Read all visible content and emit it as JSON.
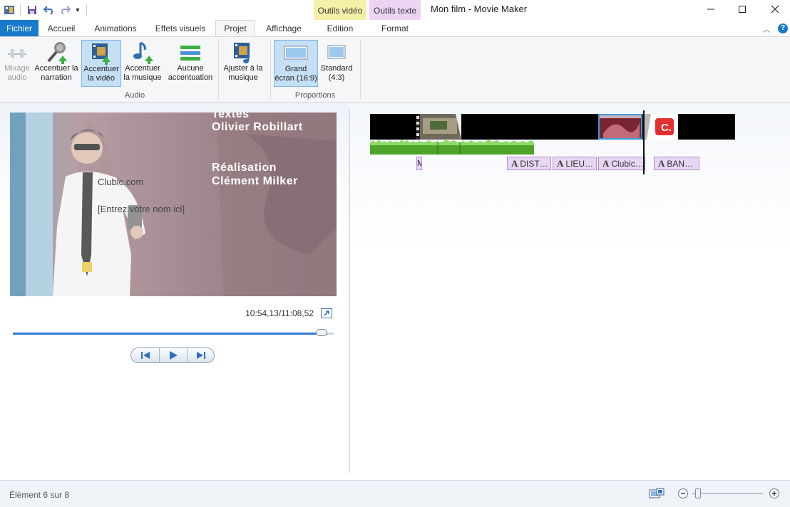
{
  "window": {
    "title": "Mon film - Movie Maker",
    "context_tabs": [
      "Outils vidéo",
      "Outils texte"
    ],
    "controls": [
      "minimize-icon",
      "maximize-icon",
      "close-icon"
    ]
  },
  "quick_access": {
    "icons": [
      "app-menu-icon",
      "save-icon",
      "undo-icon",
      "redo-icon",
      "customize-icon"
    ]
  },
  "tabs": {
    "file": "Fichier",
    "items": [
      "Accueil",
      "Animations",
      "Effets visuels",
      "Projet",
      "Affichage",
      "Edition",
      "Format"
    ],
    "active": "Projet"
  },
  "ribbon": {
    "audio_group": "Audio",
    "proportions_group": "Proportions",
    "buttons": {
      "mix_1": "Mixage",
      "mix_2": "audio",
      "narr_1": "Accentuer la",
      "narr_2": "narration",
      "video_1": "Accentuer",
      "video_2": "la vidéo",
      "music_1": "Accentuer",
      "music_2": "la musique",
      "none_1": "Aucune",
      "none_2": "accentuation",
      "fit_1": "Ajuster à la",
      "fit_2": "musique",
      "wide_1": "Grand",
      "wide_2": "écran (16:9)",
      "std_1": "Standard",
      "std_2": "(4:3)"
    }
  },
  "preview": {
    "credits": {
      "line1": "Textes",
      "line2": "Olivier Robillart",
      "line3": "Réalisation",
      "line4": "Clément Milker",
      "site": "Clubic.com",
      "name_placeholder": "[Entrez votre nom ici]"
    },
    "time": "10:54,13/11:08,52",
    "progress": 0.98
  },
  "timeline": {
    "captions": [
      "M",
      "A DIST…",
      "A LIEU…",
      "A Clubic…",
      "A BAN…"
    ]
  },
  "status": {
    "text": "Élément 6 sur 8",
    "zoom": 0.05
  },
  "colors": {
    "accent": "#1979ca",
    "outils_video": "#f5f0a8",
    "outils_texte": "#ecd4f2",
    "selected": "#c5dff5"
  }
}
